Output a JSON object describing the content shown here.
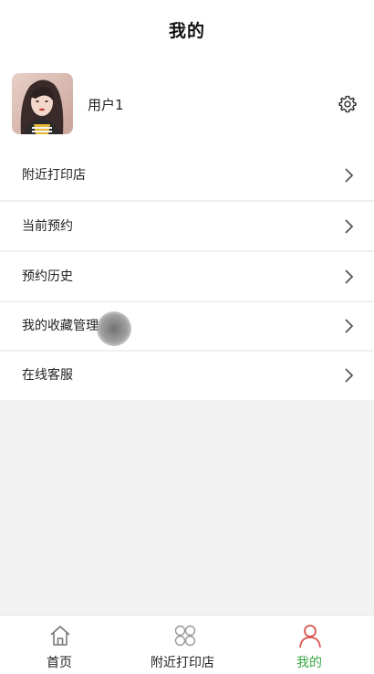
{
  "header": {
    "title": "我的"
  },
  "profile": {
    "username": "用户1"
  },
  "menu": [
    {
      "label": "附近打印店"
    },
    {
      "label": "当前预约"
    },
    {
      "label": "预约历史"
    },
    {
      "label": "我的收藏管理"
    },
    {
      "label": "在线客服"
    }
  ],
  "tabbar": {
    "items": [
      {
        "label": "首页",
        "icon": "home-icon",
        "active": false
      },
      {
        "label": "附近打印店",
        "icon": "grid-icon",
        "active": false
      },
      {
        "label": "我的",
        "icon": "user-icon",
        "active": true
      }
    ],
    "active_color": "#3aa845",
    "inactive_color": "#222222"
  },
  "colors": {
    "background": "#f2f2f2",
    "surface": "#ffffff",
    "accent_icon": "#d9534f"
  }
}
